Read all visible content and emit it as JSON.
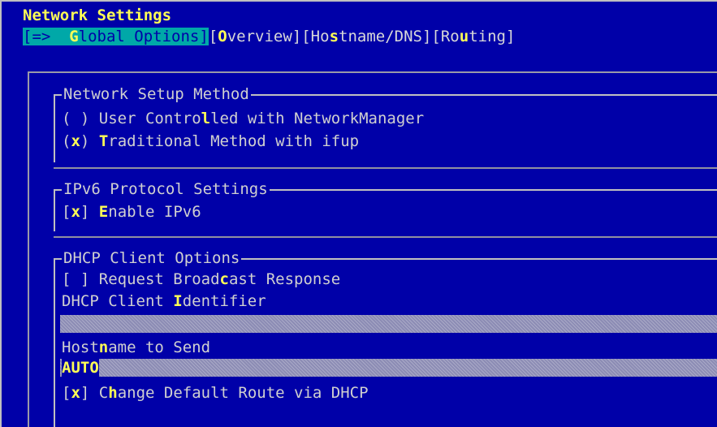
{
  "window": {
    "title": "Network Settings"
  },
  "tabs": [
    {
      "prefix": "[=>  ",
      "hot": "G",
      "rest": "lobal Options]",
      "active": true
    },
    {
      "prefix": "[",
      "hot": "O",
      "rest": "verview]",
      "active": false
    },
    {
      "prefix": "[Ho",
      "hot": "s",
      "rest": "tname/DNS]",
      "active": false
    },
    {
      "prefix": "[Ro",
      "hot": "u",
      "rest": "ting]",
      "active": false
    }
  ],
  "network_setup": {
    "title": "Network Setup Method",
    "option1": {
      "mark": " ",
      "prefix": " User Contro",
      "hot": "l",
      "rest": "led with NetworkManager"
    },
    "option2": {
      "mark": "x",
      "prefix": " ",
      "hot": "T",
      "rest": "raditional Method with ifup"
    }
  },
  "ipv6": {
    "title": "IPv6 Protocol Settings",
    "enable": {
      "mark": "x",
      "hot": "E",
      "rest": "nable IPv6"
    }
  },
  "dhcp": {
    "title": "DHCP Client Options",
    "broadcast": {
      "mark": " ",
      "prefix": " Request Broad",
      "hot": "c",
      "rest": "ast Response"
    },
    "identifier_label": {
      "prefix": "DHCP Client ",
      "hot": "I",
      "rest": "dentifier"
    },
    "identifier_value": "",
    "hostname_label": {
      "prefix": "Host",
      "hot": "n",
      "rest": "ame to Send"
    },
    "hostname_value": "AUTO",
    "default_route": {
      "mark": "x",
      "prefix": " C",
      "hot": "h",
      "rest": "ange Default Route via DHCP"
    }
  }
}
